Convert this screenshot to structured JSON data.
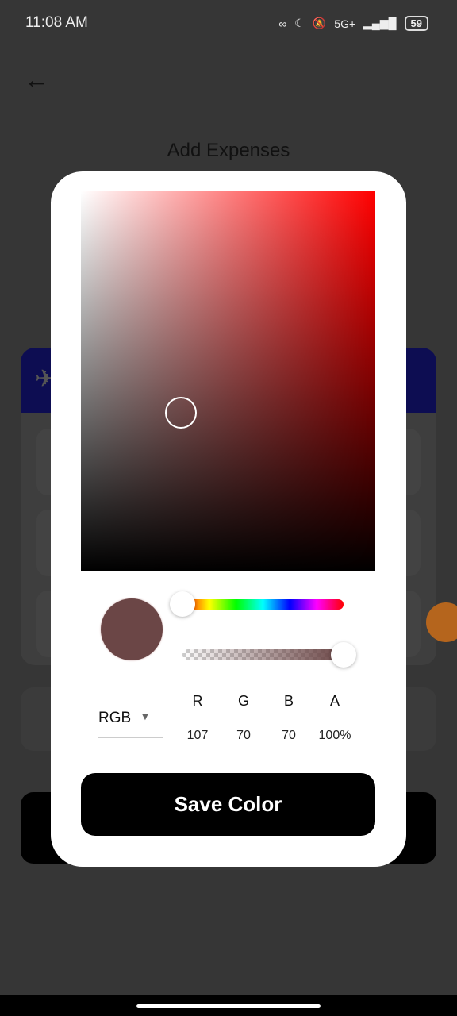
{
  "status_bar": {
    "time": "11:08 AM",
    "battery": "59",
    "network": "5G+"
  },
  "page": {
    "title": "Add Expenses"
  },
  "color_picker": {
    "selected_color": "#6B4646",
    "hue_degrees": 0,
    "alpha_fraction": 1.0,
    "mode": "RGB",
    "channels": [
      {
        "label": "R",
        "value": "107"
      },
      {
        "label": "G",
        "value": "70"
      },
      {
        "label": "B",
        "value": "70"
      },
      {
        "label": "A",
        "value": "100%"
      }
    ],
    "save_label": "Save Color"
  },
  "colors": {
    "header_navy": "#0D0D52",
    "accent_orange": "#B5651D"
  }
}
